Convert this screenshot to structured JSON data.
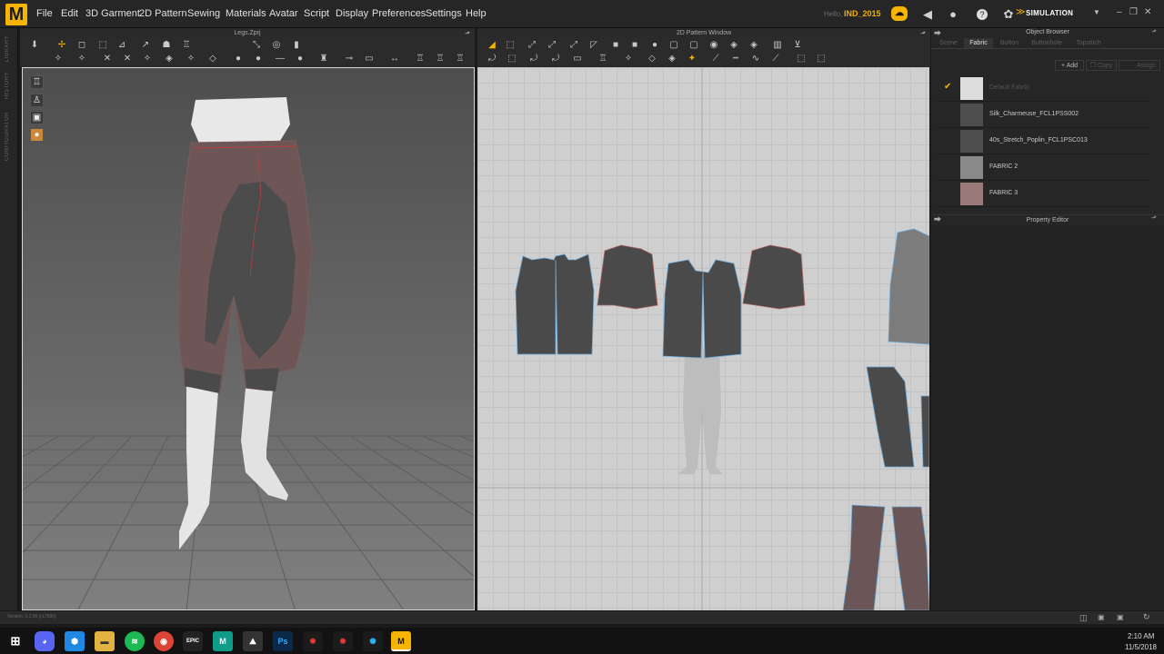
{
  "app": {
    "logo": "M"
  },
  "menu": [
    "File",
    "Edit",
    "3D Garment",
    "2D Pattern",
    "Sewing",
    "Materials",
    "Avatar",
    "Script",
    "Display",
    "Preferences",
    "Settings",
    "Help"
  ],
  "user": {
    "hello": "Hello,",
    "name": "IND_2015"
  },
  "mode": {
    "label": "SIMULATION"
  },
  "sidebar_tabs": [
    "LIBRARY",
    "HISTORY",
    "CONFIGURATOR"
  ],
  "panel3d": {
    "title": "Legs.Zprj",
    "version": "Version: 3.2.96    (r17580)"
  },
  "panel2d": {
    "title": "2D Pattern Window"
  },
  "object_browser": {
    "title": "Object Browser",
    "tabs": [
      "Scene",
      "Fabric",
      "Button",
      "Buttonhole",
      "Topstitch"
    ],
    "active_tab": "Fabric",
    "buttons": {
      "add": "Add",
      "copy": "Copy",
      "assign": "Assign"
    },
    "fabrics": [
      {
        "name": "Default Fabric",
        "color": "#dcdcdc",
        "checked": true
      },
      {
        "name": "Silk_Charmeuse_FCL1PSS002",
        "color": "#4e4e4e",
        "checked": false
      },
      {
        "name": "40s_Stretch_Poplin_FCL1PSC013",
        "color": "#4e4e4e",
        "checked": false
      },
      {
        "name": "FABRIC 2",
        "color": "#8a8a8a",
        "checked": false
      },
      {
        "name": "FABRIC 3",
        "color": "#9a7a7a",
        "checked": false
      }
    ]
  },
  "property_editor": {
    "title": "Property Editor"
  },
  "taskbar": {
    "time": "2:10 AM",
    "date": "11/5/2018"
  },
  "colors": {
    "accent": "#f6b400",
    "pattern_fill": "#4a4a4a",
    "pattern_red": "#8a6666"
  }
}
